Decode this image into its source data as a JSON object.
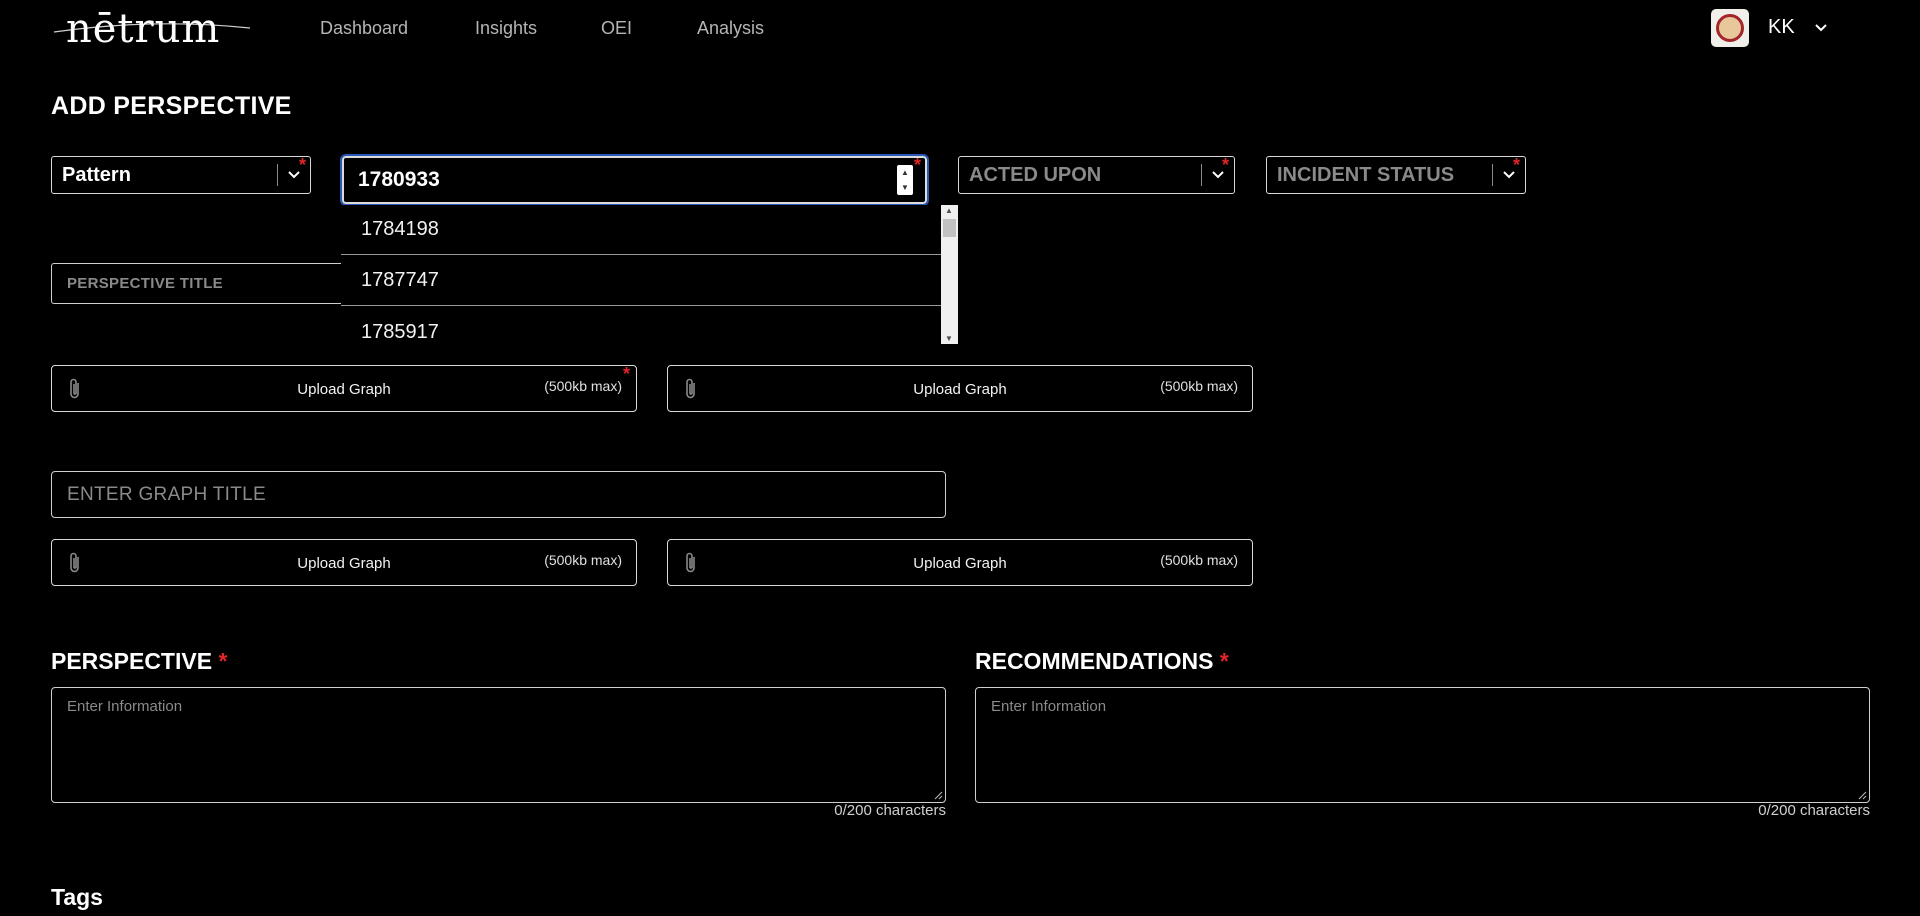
{
  "nav": {
    "logo_text": "nētrum",
    "links": [
      "Dashboard",
      "Insights",
      "OEI",
      "Analysis"
    ],
    "user_initials": "KK"
  },
  "page": {
    "title": "ADD PERSPECTIVE"
  },
  "selects": {
    "type": {
      "value": "Pattern"
    },
    "incident_id": {
      "value": "1780933"
    },
    "acted_upon": {
      "placeholder": "ACTED UPON"
    },
    "incident_status": {
      "placeholder": "INCIDENT STATUS"
    }
  },
  "dropdown": {
    "options": [
      "1784198",
      "1787747",
      "1785917"
    ]
  },
  "perspective_title": {
    "placeholder": "PERSPECTIVE TITLE"
  },
  "uploads": {
    "label": "Upload Graph",
    "max": "(500kb max)"
  },
  "graph_title": {
    "placeholder": "ENTER GRAPH TITLE"
  },
  "perspective": {
    "heading": "PERSPECTIVE",
    "placeholder": "Enter Information",
    "counter": "0/200 characters"
  },
  "recommendations": {
    "heading": "RECOMMENDATIONS",
    "placeholder": "Enter Information",
    "counter": "0/200 characters"
  },
  "tags": {
    "heading": "Tags"
  },
  "colors": {
    "background": "#000000",
    "required": "#e0262b",
    "focus": "#2b57b8",
    "muted": "#8a8a8a"
  }
}
